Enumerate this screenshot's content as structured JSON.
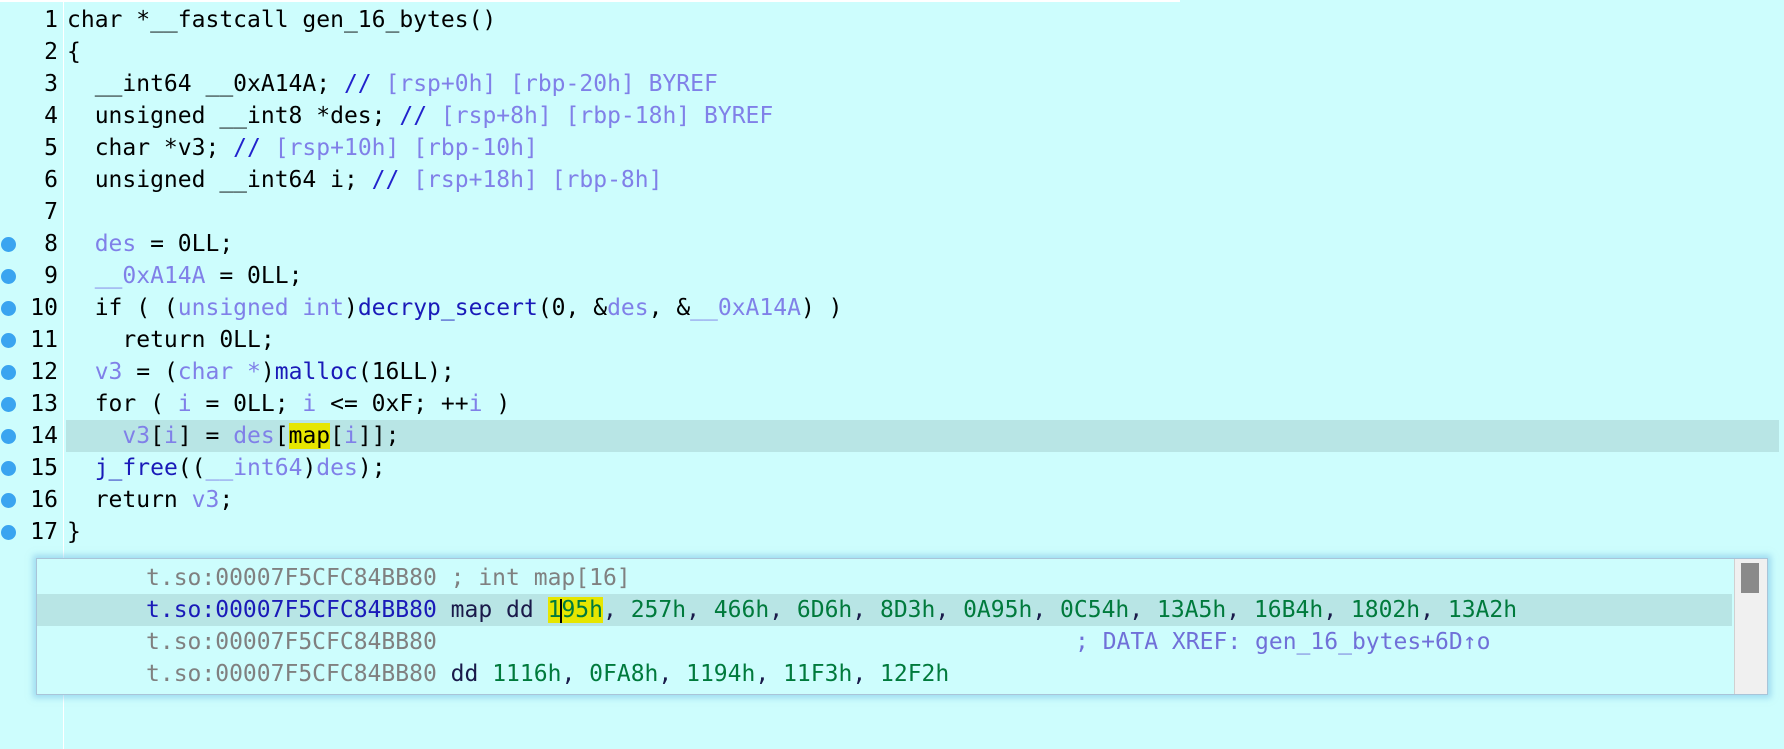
{
  "code_lines": [
    {
      "num": "1",
      "dot": false,
      "hl": false,
      "html": "char *__fastcall gen_16_bytes()"
    },
    {
      "num": "2",
      "dot": false,
      "hl": false,
      "html": "{"
    },
    {
      "num": "3",
      "dot": false,
      "hl": false,
      "html": "  __int64 __0xA14A; <span class=\"cm\">//</span> <span class=\"ad\">[rsp+0h] [rbp-20h] BYREF</span>"
    },
    {
      "num": "4",
      "dot": false,
      "hl": false,
      "html": "  unsigned __int8 *des; <span class=\"cm\">//</span> <span class=\"ad\">[rsp+8h] [rbp-18h] BYREF</span>"
    },
    {
      "num": "5",
      "dot": false,
      "hl": false,
      "html": "  char *v3; <span class=\"cm\">//</span> <span class=\"ad\">[rsp+10h] [rbp-10h]</span>"
    },
    {
      "num": "6",
      "dot": false,
      "hl": false,
      "html": "  unsigned __int64 i; <span class=\"cm\">//</span> <span class=\"ad\">[rsp+18h] [rbp-8h]</span>"
    },
    {
      "num": "7",
      "dot": false,
      "hl": false,
      "html": ""
    },
    {
      "num": "8",
      "dot": true,
      "hl": false,
      "html": "  <span class=\"var\">des</span> = 0LL;"
    },
    {
      "num": "9",
      "dot": true,
      "hl": false,
      "html": "  <span class=\"var\">__0xA14A</span> = 0LL;"
    },
    {
      "num": "10",
      "dot": true,
      "hl": false,
      "html": "  if ( (<span class=\"ad\">unsigned int</span>)<span class=\"fn\">decryp_secert</span>(0, &amp;<span class=\"var\">des</span>, &amp;<span class=\"var\">__0xA14A</span>) )"
    },
    {
      "num": "11",
      "dot": true,
      "hl": false,
      "html": "    return 0LL;"
    },
    {
      "num": "12",
      "dot": true,
      "hl": false,
      "html": "  <span class=\"var\">v3</span> = (<span class=\"ad\">char *</span>)<span class=\"fn\">malloc</span>(16LL);"
    },
    {
      "num": "13",
      "dot": true,
      "hl": false,
      "html": "  for ( <span class=\"var\">i</span> = 0LL; <span class=\"var\">i</span> &lt;= 0xF; ++<span class=\"var\">i</span> )"
    },
    {
      "num": "14",
      "dot": true,
      "hl": true,
      "html": "    <span class=\"var\">v3</span>[<span class=\"var\">i</span>] = <span class=\"var\">des</span>[<span class=\"mk\">map</span>[<span class=\"var\">i</span>]];"
    },
    {
      "num": "15",
      "dot": true,
      "hl": false,
      "html": "  <span class=\"fn\">j_free</span>((<span class=\"ad\">__int64</span>)<span class=\"var\">des</span>);"
    },
    {
      "num": "16",
      "dot": true,
      "hl": false,
      "html": "  return <span class=\"var\">v3</span>;"
    },
    {
      "num": "17",
      "dot": true,
      "hl": false,
      "html": "}"
    }
  ],
  "popup": {
    "lines": [
      {
        "hl": false,
        "html": "<span class=\"gray\">t.so:00007F5CFC84BB80 ; int map[16]</span>"
      },
      {
        "hl": true,
        "html": "<span class=\"blue\">t.so:00007F5CFC84BB80</span> <span class=\"dark\">map dd </span><span class=\"mk green\">1<span class=\"cursor\"></span>95h</span><span class=\"dark\">, </span><span class=\"green\">257h</span><span class=\"dark\">, </span><span class=\"green\">466h</span><span class=\"dark\">, </span><span class=\"green\">6D6h</span><span class=\"dark\">, </span><span class=\"green\">8D3h</span><span class=\"dark\">, </span><span class=\"green\">0A95h</span><span class=\"dark\">, </span><span class=\"green\">0C54h</span><span class=\"dark\">, </span><span class=\"green\">13A5h</span><span class=\"dark\">, </span><span class=\"green\">16B4h</span><span class=\"dark\">, </span><span class=\"green\">1802h</span><span class=\"dark\">, </span><span class=\"green\">13A2h</span>"
      },
      {
        "hl": false,
        "html": "<span class=\"gray\">t.so:00007F5CFC84BB80</span>",
        "xref": "; DATA XREF: gen_16_bytes+6D↑o"
      },
      {
        "hl": false,
        "html": "<span class=\"gray\">t.so:00007F5CFC84BB80</span> <span class=\"dark\">dd </span><span class=\"green\">1116h</span><span class=\"dark\">, </span><span class=\"green\">0FA8h</span><span class=\"dark\">, </span><span class=\"green\">1194h</span><span class=\"dark\">, </span><span class=\"green\">11F3h</span><span class=\"dark\">, </span><span class=\"green\">12F2h</span>"
      }
    ]
  }
}
